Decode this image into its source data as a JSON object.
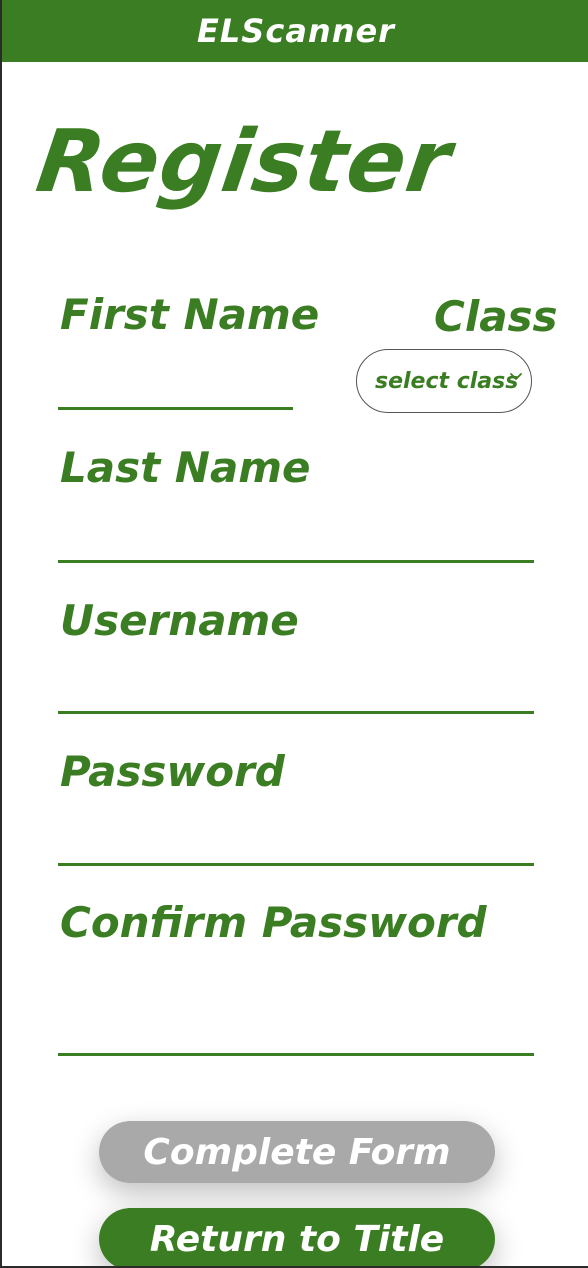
{
  "header": {
    "title": "ELScanner"
  },
  "page": {
    "title": "Register"
  },
  "form": {
    "first_name_label": "First Name",
    "class_label": "Class",
    "class_select_value": "select class",
    "last_name_label": "Last Name",
    "username_label": "Username",
    "password_label": "Password",
    "confirm_password_label": "Confirm Password"
  },
  "buttons": {
    "complete_form": "Complete Form",
    "return_to_title": "Return to Title"
  },
  "colors": {
    "accent": "#3a7d22",
    "disabled_button": "#a9a9a9"
  }
}
